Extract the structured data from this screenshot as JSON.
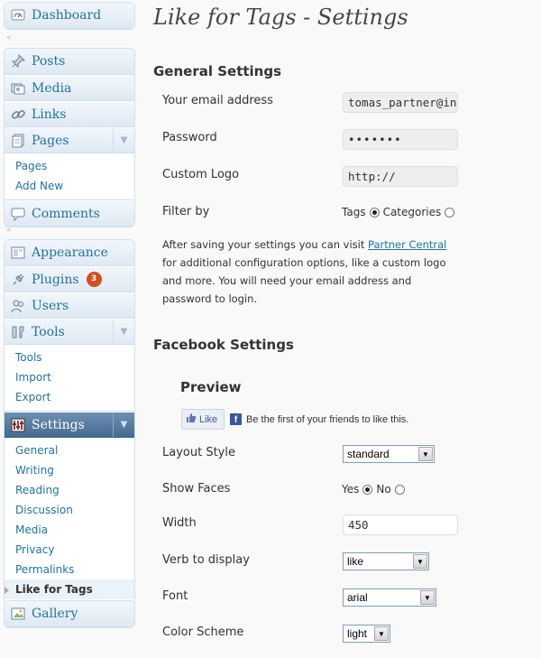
{
  "sidebar": {
    "group1": [
      {
        "label": "Dashboard",
        "icon": "dashboard-icon"
      }
    ],
    "group2": {
      "posts": "Posts",
      "media": "Media",
      "links": "Links",
      "pages": "Pages",
      "pages_sub": [
        "Pages",
        "Add New"
      ],
      "comments": "Comments"
    },
    "group3": {
      "appearance": "Appearance",
      "plugins": "Plugins",
      "plugins_badge": "3",
      "users": "Users",
      "tools": "Tools",
      "tools_sub": [
        "Tools",
        "Import",
        "Export"
      ],
      "settings": "Settings",
      "settings_sub": [
        "General",
        "Writing",
        "Reading",
        "Discussion",
        "Media",
        "Privacy",
        "Permalinks",
        "Like for Tags"
      ]
    },
    "group4": {
      "gallery": "Gallery"
    }
  },
  "main": {
    "page_title": "Like for Tags - Settings",
    "general": {
      "title": "General Settings",
      "email_label": "Your email address",
      "email_value": "tomas_partner@ing",
      "password_label": "Password",
      "password_value": "•••••••",
      "logo_label": "Custom Logo",
      "logo_value": "http://",
      "filter_label": "Filter by",
      "filter_opt1": "Tags",
      "filter_opt2": "Categories",
      "desc_before": "After saving your settings you can visit ",
      "desc_link": "Partner Central",
      "desc_after": " for additional configuration options, like a custom logo and more. You will need your email address and password to login."
    },
    "facebook": {
      "title": "Facebook Settings",
      "preview_title": "Preview",
      "like_button": "Like",
      "like_text": "Be the first of your friends to like this.",
      "layout_label": "Layout Style",
      "layout_value": "standard",
      "faces_label": "Show Faces",
      "faces_yes": "Yes",
      "faces_no": "No",
      "width_label": "Width",
      "width_value": "450",
      "verb_label": "Verb to display",
      "verb_value": "like",
      "font_label": "Font",
      "font_value": "arial",
      "color_label": "Color Scheme",
      "color_value": "light"
    }
  },
  "colors": {
    "link": "#21759b",
    "current_menu": "#466b90",
    "badge": "#d54e21",
    "facebook": "#3b5998"
  }
}
